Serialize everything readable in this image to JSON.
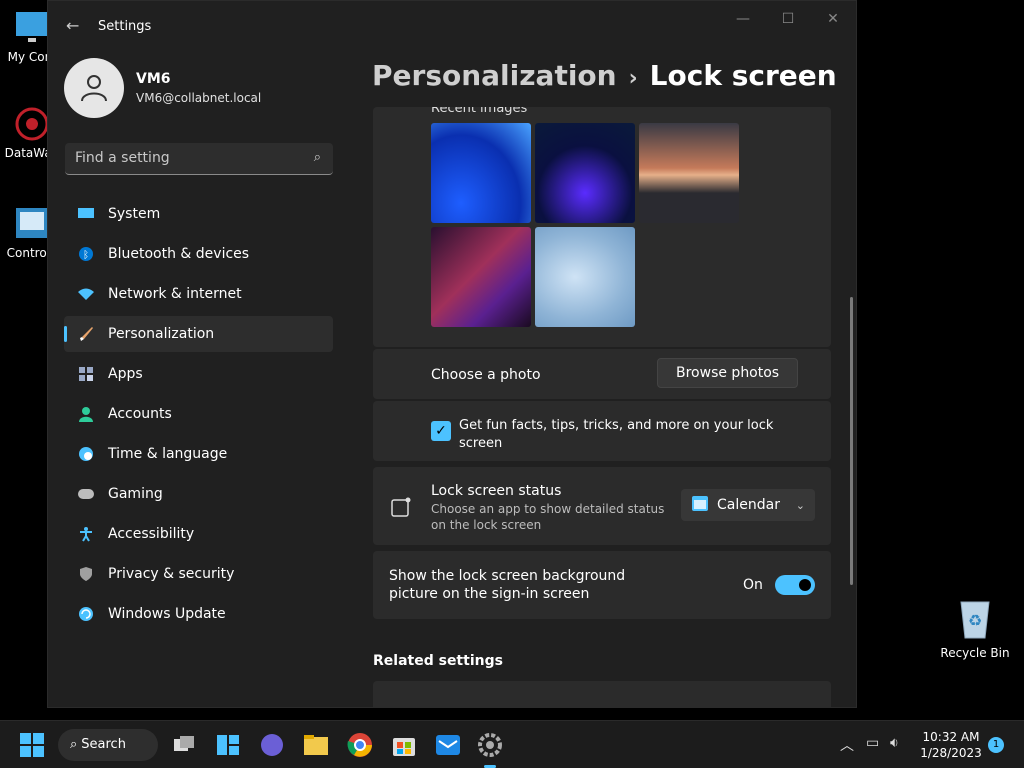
{
  "desktop": {
    "icons": [
      {
        "label": "My Com"
      },
      {
        "label": "DataWag"
      },
      {
        "label": "Control I"
      }
    ],
    "recycle_bin": "Recycle Bin"
  },
  "window": {
    "title": "Settings",
    "back_icon": "back-arrow-icon",
    "controls": [
      "minimize",
      "maximize",
      "close"
    ]
  },
  "profile": {
    "name": "VM6",
    "email": "VM6@collabnet.local"
  },
  "search": {
    "placeholder": "Find a setting"
  },
  "nav": {
    "items": [
      {
        "label": "System",
        "icon": "system-icon",
        "color": "#4cc2ff"
      },
      {
        "label": "Bluetooth & devices",
        "icon": "bluetooth-icon",
        "color": "#0078d4"
      },
      {
        "label": "Network & internet",
        "icon": "wifi-icon",
        "color": "#4cc2ff"
      },
      {
        "label": "Personalization",
        "icon": "brush-icon",
        "color": "#e6a36b",
        "active": true
      },
      {
        "label": "Apps",
        "icon": "apps-icon",
        "color": "#9aa9c7"
      },
      {
        "label": "Accounts",
        "icon": "accounts-icon",
        "color": "#2ecc9a"
      },
      {
        "label": "Time & language",
        "icon": "clock-globe-icon",
        "color": "#4cc2ff"
      },
      {
        "label": "Gaming",
        "icon": "gamepad-icon",
        "color": "#bdbdbd"
      },
      {
        "label": "Accessibility",
        "icon": "accessibility-icon",
        "color": "#4cc2ff"
      },
      {
        "label": "Privacy & security",
        "icon": "shield-icon",
        "color": "#a0a0a0"
      },
      {
        "label": "Windows Update",
        "icon": "update-icon",
        "color": "#4cc2ff"
      }
    ]
  },
  "breadcrumb": {
    "parent": "Personalization",
    "separator": "›",
    "current": "Lock screen"
  },
  "content": {
    "recent_images_label": "Recent images",
    "choose_photo": "Choose a photo",
    "browse_button": "Browse photos",
    "fun_facts": "Get fun facts, tips, tricks, and more on your lock screen",
    "fun_facts_checked": true,
    "status": {
      "title": "Lock screen status",
      "desc": "Choose an app to show detailed status on the lock screen",
      "value": "Calendar"
    },
    "background": {
      "label": "Show the lock screen background picture on the sign-in screen",
      "state": "On",
      "on": true
    },
    "related": "Related settings"
  },
  "taskbar": {
    "search_label": "Search",
    "time": "10:32 AM",
    "date": "1/28/2023",
    "notifications": "1"
  }
}
